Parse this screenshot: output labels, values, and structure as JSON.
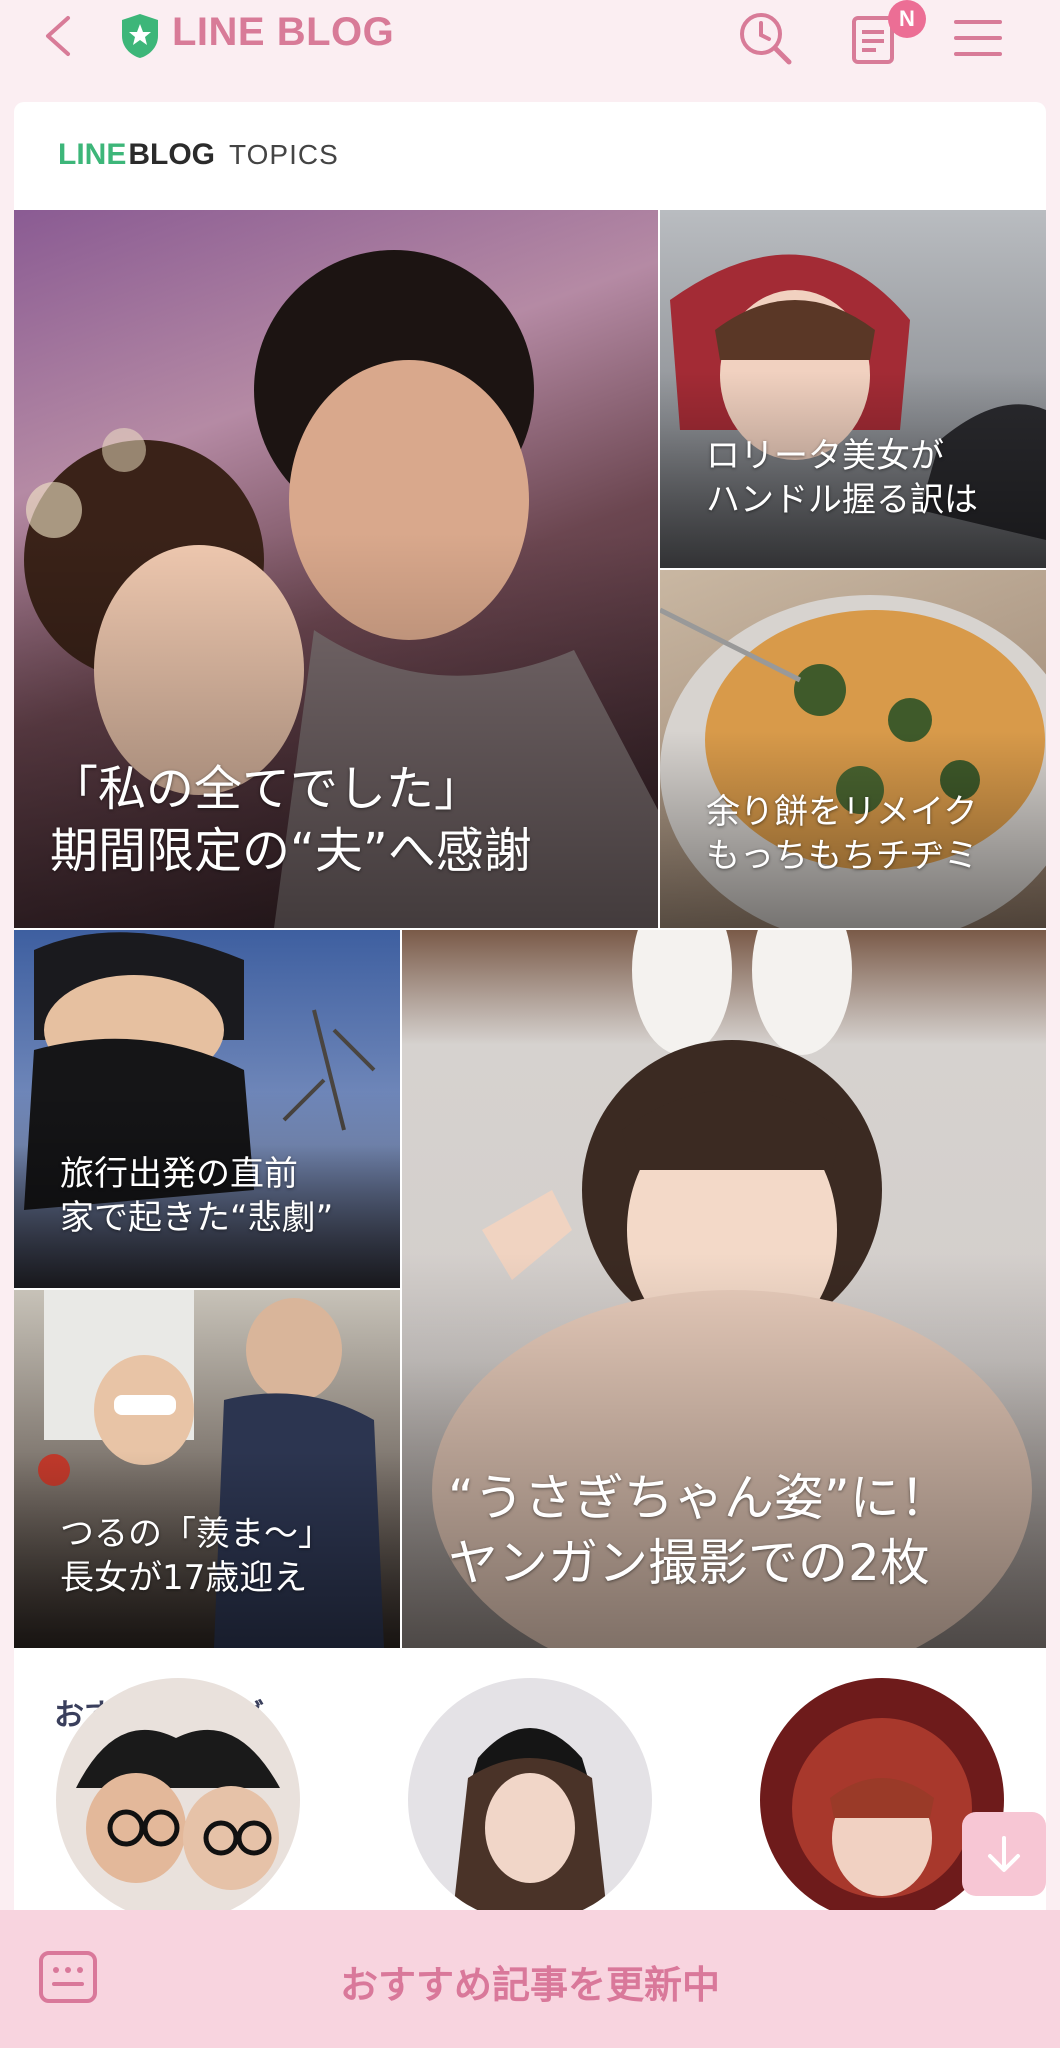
{
  "header": {
    "brand": "LINE BLOG",
    "badge": "N",
    "icons": [
      "back-arrow-icon",
      "shield-star-icon",
      "search-history-icon",
      "article-list-icon",
      "hamburger-menu-icon"
    ],
    "brand_color": "#d87b98",
    "badge_color": "#ec6e95"
  },
  "topics": {
    "logo_line": "LINE",
    "logo_blog": "BLOG",
    "logo_topics": "TOPICS",
    "tiles": [
      {
        "caption": "「私の全てでした」\n期間限定の“夫”へ感謝"
      },
      {
        "caption": "ロリータ美女が\nハンドル握る訳は"
      },
      {
        "caption": "余り餅をリメイク\nもっちもちチヂミ"
      },
      {
        "caption": "旅行出発の直前\n家で起きた“悲劇”"
      },
      {
        "caption": "つるの「羨ま〜」\n長女が17歳迎え"
      },
      {
        "caption": "“うさぎちゃん姿”に！\nヤンガン撮影での2枚"
      }
    ]
  },
  "recommended": {
    "title": "おすすめブログ"
  },
  "footer": {
    "status": "おすすめ記事を更新中",
    "background": "#f8d4df"
  }
}
